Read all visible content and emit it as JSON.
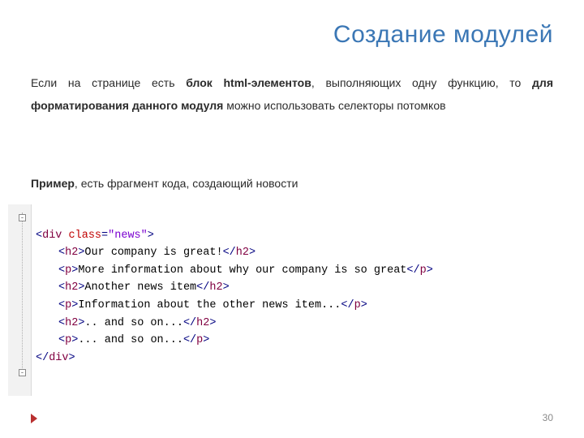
{
  "title": "Создание модулей",
  "paragraph": {
    "t1": "Если на странице есть ",
    "b1": "блок html-элементов",
    "t2": ", выполняющих одну функцию, то ",
    "b2": "для форматирования данного модуля",
    "t3": " можно использовать селекторы потомков"
  },
  "example": {
    "b": "Пример",
    "rest": ", есть фрагмент кода, создающий новости"
  },
  "code": {
    "div_open": {
      "a1": "<",
      "name": "div",
      "sp": " ",
      "attr": "class",
      "eq": "=",
      "val": "\"news\"",
      "a2": ">"
    },
    "lines": [
      {
        "open_a1": "<",
        "open_name": "h2",
        "open_a2": ">",
        "text": "Our company is great!",
        "close_a1": "</",
        "close_name": "h2",
        "close_a2": ">"
      },
      {
        "open_a1": "<",
        "open_name": "p",
        "open_a2": ">",
        "text": "More information about why our company is so great",
        "close_a1": "</",
        "close_name": "p",
        "close_a2": ">"
      },
      {
        "open_a1": "<",
        "open_name": "h2",
        "open_a2": ">",
        "text": "Another news item",
        "close_a1": "</",
        "close_name": "h2",
        "close_a2": ">"
      },
      {
        "open_a1": "<",
        "open_name": "p",
        "open_a2": ">",
        "text": "Information about the other news item...",
        "close_a1": "</",
        "close_name": "p",
        "close_a2": ">"
      },
      {
        "open_a1": "<",
        "open_name": "h2",
        "open_a2": ">",
        "text": ".. and so on...",
        "close_a1": "</",
        "close_name": "h2",
        "close_a2": ">"
      },
      {
        "open_a1": "<",
        "open_name": "p",
        "open_a2": ">",
        "text": "... and so on...",
        "close_a1": "</",
        "close_name": "p",
        "close_a2": ">"
      }
    ],
    "div_close": {
      "a1": "</",
      "name": "div",
      "a2": ">"
    }
  },
  "page_number": "30"
}
